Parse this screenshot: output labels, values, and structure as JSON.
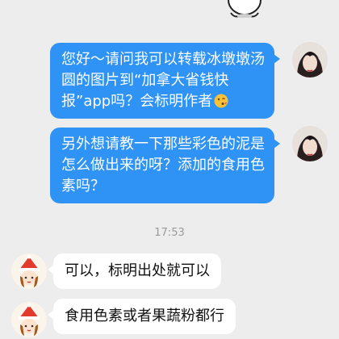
{
  "messages": [
    {
      "side": "out",
      "text": "您好～请问我可以转载冰墩墩汤圆的图片到“加拿大省钱快报”app吗？会标明作者",
      "emoji": "kissing-face-emoji"
    },
    {
      "side": "out",
      "text": "另外想请教一下那些彩色的泥是怎么做出来的呀？添加的食用色素吗？"
    },
    {
      "side": "in",
      "text": "可以，标明出处就可以"
    },
    {
      "side": "in",
      "text": "食用色素或者果蔬粉都行"
    }
  ],
  "timestamp": "17:53",
  "colors": {
    "outgoing_bubble": "#2e93f5",
    "incoming_bubble": "#ffffff",
    "background": "#ededed"
  }
}
